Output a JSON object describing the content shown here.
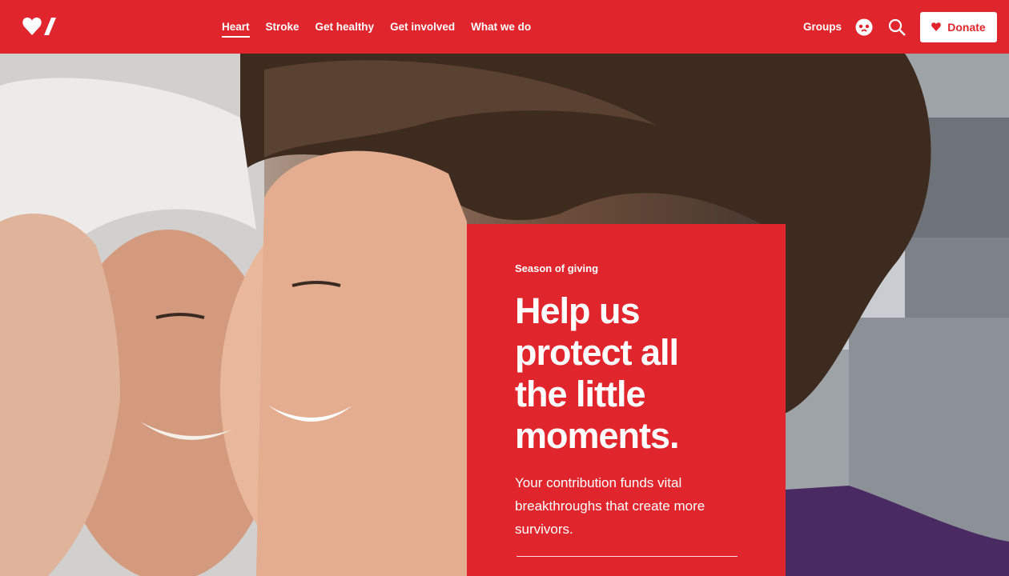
{
  "header": {
    "nav": [
      {
        "label": "Heart",
        "active": true
      },
      {
        "label": "Stroke",
        "active": false
      },
      {
        "label": "Get healthy",
        "active": false
      },
      {
        "label": "Get involved",
        "active": false
      },
      {
        "label": "What we do",
        "active": false
      }
    ],
    "groups_label": "Groups",
    "donate_label": "Donate"
  },
  "hero": {
    "eyebrow": "Season of giving",
    "headline": "Help us protect all the little moments.",
    "body": "Your contribution funds vital breakthroughs that create more survivors."
  },
  "colors": {
    "brand_red": "#e0262c",
    "white": "#ffffff"
  },
  "icons": [
    "heart-logo-icon",
    "support-icon",
    "search-icon",
    "heart-icon"
  ]
}
